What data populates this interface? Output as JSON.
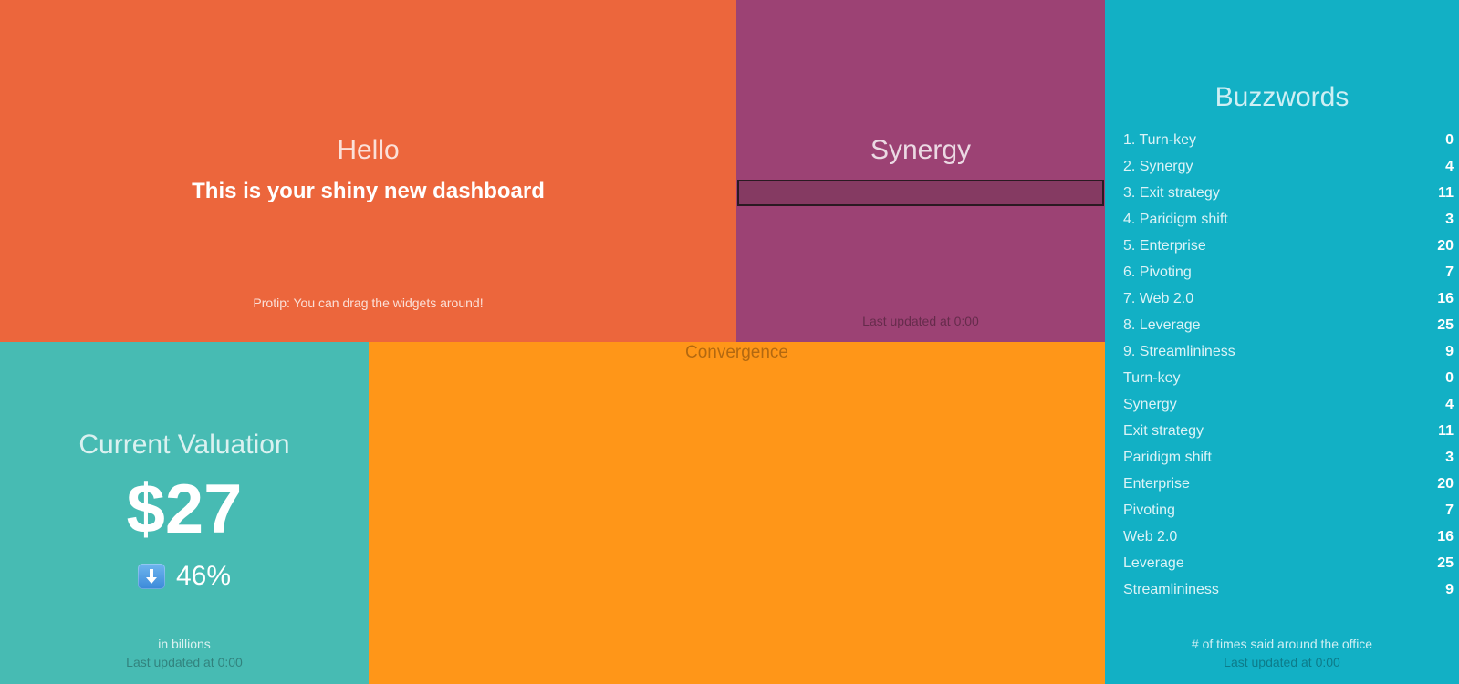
{
  "colors": {
    "hello_bg": "#ec663c",
    "synergy_bg": "#9c4274",
    "convergence_bg": "#ff9618",
    "valuation_bg": "#47bbb3",
    "buzzwords_bg": "#12b0c5"
  },
  "hello": {
    "title": "Hello",
    "text": "This is your shiny new dashboard",
    "more_info": "Protip: You can drag the widgets around!"
  },
  "synergy": {
    "title": "Synergy",
    "meter_percent": 0,
    "updated_at": "Last updated at 0:00"
  },
  "convergence": {
    "title": "Convergence"
  },
  "valuation": {
    "title": "Current Valuation",
    "value": "$27",
    "arrow_icon": "arrow-down-icon",
    "change": "46%",
    "more_info": "in billions",
    "updated_at": "Last updated at 0:00"
  },
  "buzzwords": {
    "title": "Buzzwords",
    "items": [
      {
        "label": "1. Turn-key",
        "value": "0"
      },
      {
        "label": "2. Synergy",
        "value": "4"
      },
      {
        "label": "3. Exit strategy",
        "value": "11"
      },
      {
        "label": "4. Paridigm shift",
        "value": "3"
      },
      {
        "label": "5. Enterprise",
        "value": "20"
      },
      {
        "label": "6. Pivoting",
        "value": "7"
      },
      {
        "label": "7. Web 2.0",
        "value": "16"
      },
      {
        "label": "8. Leverage",
        "value": "25"
      },
      {
        "label": "9. Streamlininess",
        "value": "9"
      },
      {
        "label": "Turn-key",
        "value": "0"
      },
      {
        "label": "Synergy",
        "value": "4"
      },
      {
        "label": "Exit strategy",
        "value": "11"
      },
      {
        "label": "Paridigm shift",
        "value": "3"
      },
      {
        "label": "Enterprise",
        "value": "20"
      },
      {
        "label": "Pivoting",
        "value": "7"
      },
      {
        "label": "Web 2.0",
        "value": "16"
      },
      {
        "label": "Leverage",
        "value": "25"
      },
      {
        "label": "Streamlininess",
        "value": "9"
      }
    ],
    "more_info": "# of times said around the office",
    "updated_at": "Last updated at 0:00"
  }
}
